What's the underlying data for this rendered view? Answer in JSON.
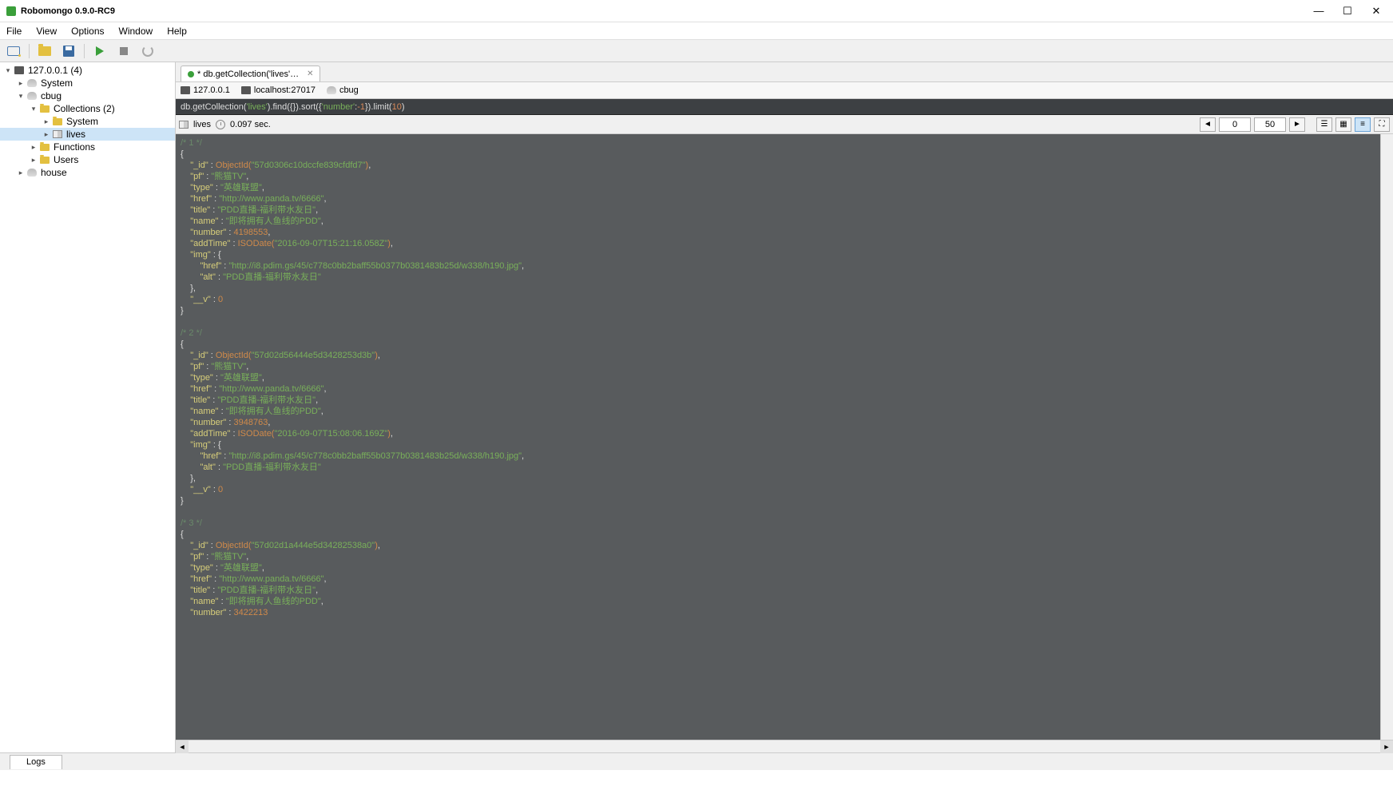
{
  "window": {
    "title": "Robomongo 0.9.0-RC9"
  },
  "menu": {
    "file": "File",
    "view": "View",
    "options": "Options",
    "window": "Window",
    "help": "Help"
  },
  "toolbar": {
    "connect": "connect",
    "open": "open",
    "save": "save",
    "play": "play",
    "stop": "stop",
    "refresh": "refresh"
  },
  "sidebar": {
    "root": "127.0.0.1 (4)",
    "items": [
      {
        "label": "System",
        "icon": "db",
        "indent": 1
      },
      {
        "label": "cbug",
        "icon": "db",
        "indent": 1,
        "expanded": true
      },
      {
        "label": "Collections (2)",
        "icon": "folder",
        "indent": 2,
        "expanded": true
      },
      {
        "label": "System",
        "icon": "folder",
        "indent": 3
      },
      {
        "label": "lives",
        "icon": "coll",
        "indent": 3,
        "selected": true
      },
      {
        "label": "Functions",
        "icon": "folder",
        "indent": 2
      },
      {
        "label": "Users",
        "icon": "folder",
        "indent": 2
      },
      {
        "label": "house",
        "icon": "db",
        "indent": 1
      }
    ]
  },
  "tab": {
    "label": "* db.getCollection('lives'…"
  },
  "conn": {
    "host": "127.0.0.1",
    "server": "localhost:27017",
    "db": "cbug"
  },
  "query_parts": {
    "p1": "db.getCollection(",
    "s1": "'lives'",
    "p2": ").find({}).sort({ ",
    "s2": "'number'",
    "p3": ": ",
    "n1": "-1",
    "p4": " }).limit(",
    "n2": "10",
    "p5": ")"
  },
  "result_bar": {
    "collection": "lives",
    "time": "0.097 sec.",
    "offset": "0",
    "limit": "50"
  },
  "docs": [
    {
      "idx": "/* 1 */",
      "_id": "57d0306c10dccfe839cfdfd7",
      "pf": "熊猫TV",
      "type": "英雄联盟",
      "href": "http://www.panda.tv/6666",
      "title": "PDD直播-福利带水友日",
      "name": "即将拥有人鱼线的PDD",
      "number": "4198553",
      "addTime": "2016-09-07T15:21:16.058Z",
      "img_href": "http://i8.pdim.gs/45/c778c0bb2baff55b0377b0381483b25d/w338/h190.jpg",
      "img_alt": "PDD直播-福利带水友日",
      "__v": "0"
    },
    {
      "idx": "/* 2 */",
      "_id": "57d02d56444e5d3428253d3b",
      "pf": "熊猫TV",
      "type": "英雄联盟",
      "href": "http://www.panda.tv/6666",
      "title": "PDD直播-福利带水友日",
      "name": "即将拥有人鱼线的PDD",
      "number": "3948763",
      "addTime": "2016-09-07T15:08:06.169Z",
      "img_href": "http://i8.pdim.gs/45/c778c0bb2baff55b0377b0381483b25d/w338/h190.jpg",
      "img_alt": "PDD直播-福利带水友日",
      "__v": "0"
    },
    {
      "idx": "/* 3 */",
      "_id": "57d02d1a444e5d34282538a0",
      "pf": "熊猫TV",
      "type": "英雄联盟",
      "href": "http://www.panda.tv/6666",
      "title": "PDD直播-福利带水友日",
      "name": "即将拥有人鱼线的PDD",
      "number": "3422213"
    }
  ],
  "status": {
    "logs": "Logs"
  }
}
